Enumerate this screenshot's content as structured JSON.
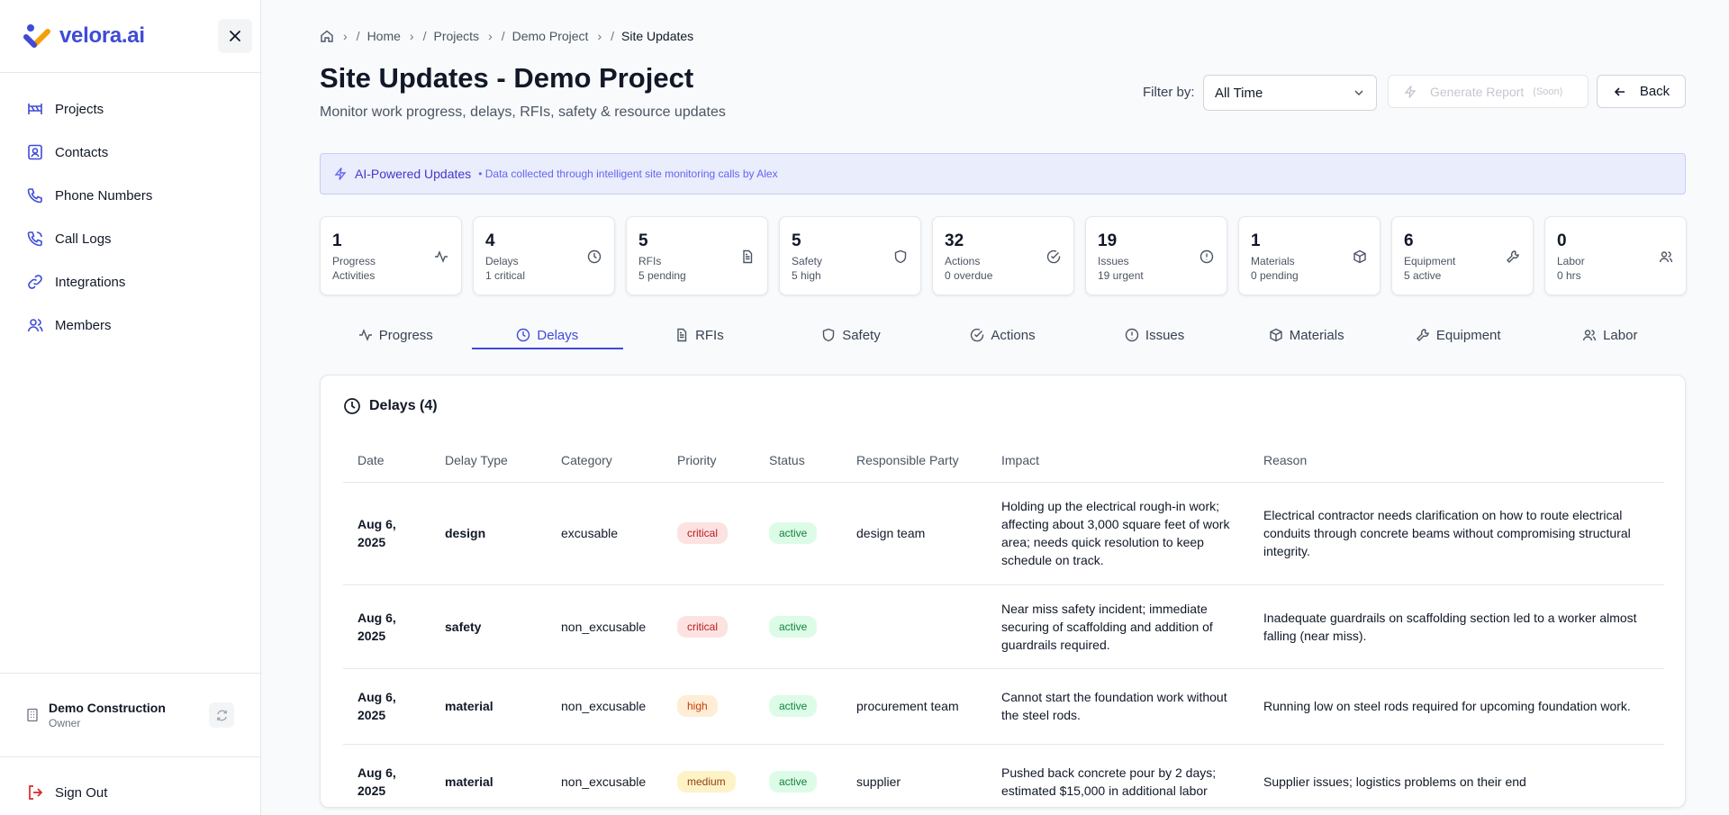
{
  "app": {
    "brand": "velora.ai",
    "accent": "#3f4bd8"
  },
  "sidebar": {
    "items": [
      {
        "label": "Projects",
        "icon": "projects-icon"
      },
      {
        "label": "Contacts",
        "icon": "contacts-icon"
      },
      {
        "label": "Phone Numbers",
        "icon": "phone-icon"
      },
      {
        "label": "Call Logs",
        "icon": "call-logs-icon"
      },
      {
        "label": "Integrations",
        "icon": "link-icon"
      },
      {
        "label": "Members",
        "icon": "users-icon"
      }
    ],
    "org": {
      "name": "Demo Construction",
      "role": "Owner"
    },
    "sign_out": "Sign Out"
  },
  "breadcrumb": {
    "home": "Home",
    "projects": "Projects",
    "project": "Demo Project",
    "current": "Site Updates"
  },
  "header": {
    "title": "Site Updates - Demo Project",
    "subtitle": "Monitor work progress, delays, RFIs, safety & resource updates",
    "filter_label": "Filter by:",
    "filter_value": "All Time",
    "generate_label": "Generate Report",
    "generate_soon": "(Soon)",
    "back_label": "Back"
  },
  "banner": {
    "title": "AI-Powered Updates",
    "desc": "• Data collected through intelligent site monitoring calls by Alex"
  },
  "stats": [
    {
      "value": "1",
      "label": "Progress",
      "sub": "Activities",
      "icon": "activity-icon"
    },
    {
      "value": "4",
      "label": "Delays",
      "sub": "1 critical",
      "icon": "clock-icon"
    },
    {
      "value": "5",
      "label": "RFIs",
      "sub": "5 pending",
      "icon": "document-icon"
    },
    {
      "value": "5",
      "label": "Safety",
      "sub": "5 high",
      "icon": "shield-icon"
    },
    {
      "value": "32",
      "label": "Actions",
      "sub": "0 overdue",
      "icon": "check-circle-icon"
    },
    {
      "value": "19",
      "label": "Issues",
      "sub": "19 urgent",
      "icon": "alert-circle-icon"
    },
    {
      "value": "1",
      "label": "Materials",
      "sub": "0 pending",
      "icon": "package-icon"
    },
    {
      "value": "6",
      "label": "Equipment",
      "sub": "5 active",
      "icon": "wrench-icon"
    },
    {
      "value": "0",
      "label": "Labor",
      "sub": "0 hrs",
      "icon": "users-icon"
    }
  ],
  "tabs": [
    {
      "label": "Progress",
      "icon": "activity-icon"
    },
    {
      "label": "Delays",
      "icon": "clock-icon"
    },
    {
      "label": "RFIs",
      "icon": "document-icon"
    },
    {
      "label": "Safety",
      "icon": "shield-icon"
    },
    {
      "label": "Actions",
      "icon": "check-circle-icon"
    },
    {
      "label": "Issues",
      "icon": "alert-circle-icon"
    },
    {
      "label": "Materials",
      "icon": "package-icon"
    },
    {
      "label": "Equipment",
      "icon": "wrench-icon"
    },
    {
      "label": "Labor",
      "icon": "users-icon"
    }
  ],
  "active_tab": "Delays",
  "delays": {
    "title": "Delays (4)",
    "columns": [
      "Date",
      "Delay Type",
      "Category",
      "Priority",
      "Status",
      "Responsible Party",
      "Impact",
      "Reason"
    ],
    "rows": [
      {
        "date": "Aug 6, 2025",
        "type": "design",
        "category": "excusable",
        "priority": "critical",
        "status": "active",
        "party": "design team",
        "impact": "Holding up the electrical rough-in work; affecting about 3,000 square feet of work area; needs quick resolution to keep schedule on track.",
        "reason": "Electrical contractor needs clarification on how to route electrical conduits through concrete beams without compromising structural integrity."
      },
      {
        "date": "Aug 6, 2025",
        "type": "safety",
        "category": "non_excusable",
        "priority": "critical",
        "status": "active",
        "party": "",
        "impact": "Near miss safety incident; immediate securing of scaffolding and addition of guardrails required.",
        "reason": "Inadequate guardrails on scaffolding section led to a worker almost falling (near miss)."
      },
      {
        "date": "Aug 6, 2025",
        "type": "material",
        "category": "non_excusable",
        "priority": "high",
        "status": "active",
        "party": "procurement team",
        "impact": "Cannot start the foundation work without the steel rods.",
        "reason": "Running low on steel rods required for upcoming foundation work."
      },
      {
        "date": "Aug 6, 2025",
        "type": "material",
        "category": "non_excusable",
        "priority": "medium",
        "status": "active",
        "party": "supplier",
        "impact": "Pushed back concrete pour by 2 days; estimated $15,000 in additional labor",
        "reason": "Supplier issues; logistics problems on their end"
      }
    ]
  }
}
